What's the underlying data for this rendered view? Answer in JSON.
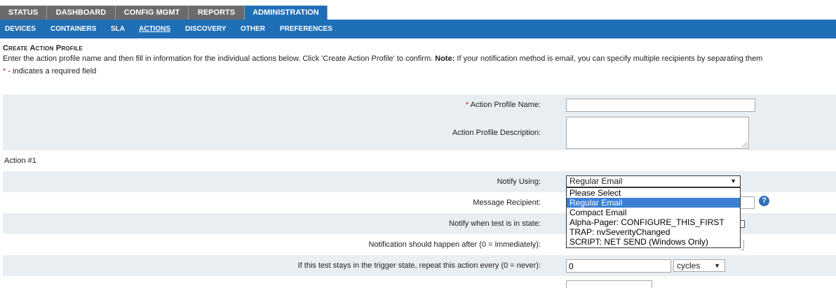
{
  "top_tabs": [
    {
      "label": "STATUS"
    },
    {
      "label": "DASHBOARD"
    },
    {
      "label": "CONFIG MGMT"
    },
    {
      "label": "REPORTS"
    },
    {
      "label": "ADMINISTRATION"
    }
  ],
  "sub_tabs": [
    {
      "label": "DEVICES"
    },
    {
      "label": "CONTAINERS"
    },
    {
      "label": "SLA"
    },
    {
      "label": "ACTIONS"
    },
    {
      "label": "DISCOVERY"
    },
    {
      "label": "OTHER"
    },
    {
      "label": "PREFERENCES"
    }
  ],
  "page": {
    "heading": "Create Action Profile",
    "instructions_a": "Enter the action profile name and then fill in information for the individual actions below. Click 'Create Action Profile' to confirm. ",
    "instructions_note": "Note:",
    "instructions_b": " If your notification method is email, you can specify multiple recipients by separating them",
    "required_star": "*",
    "required_text": " - indicates a required field"
  },
  "form": {
    "profile_name_label": "Action Profile Name:",
    "profile_name_value": "",
    "profile_desc_label": "Action Profile Description:",
    "action_section": "Action #1",
    "notify_using_label": "Notify Using:",
    "notify_using_value": "Regular Email",
    "notify_options": [
      "Please Select",
      "Regular Email",
      "Compact Email",
      "Alpha-Pager: CONFIGURE_THIS_FIRST",
      "TRAP: nvSeverityChanged",
      "SCRIPT: NET SEND (Windows Only)"
    ],
    "message_recipient_label": "Message Recipient:",
    "help_icon_text": "?",
    "notify_state_label": "Notify when test is in state:",
    "notify_after_label": "Notification should happen after (0 = immediately):",
    "repeat_label": "If this test stays in the trigger state, repeat this action every (0 = never):",
    "repeat_value": "0",
    "repeat_unit": "cycles"
  },
  "colors": {
    "active_tab": "#1f6fb7",
    "inactive_tab": "#6b6b6b",
    "row_shade": "#e9eef2",
    "selected_option": "#3b7fd5",
    "required_star": "#d22222"
  }
}
